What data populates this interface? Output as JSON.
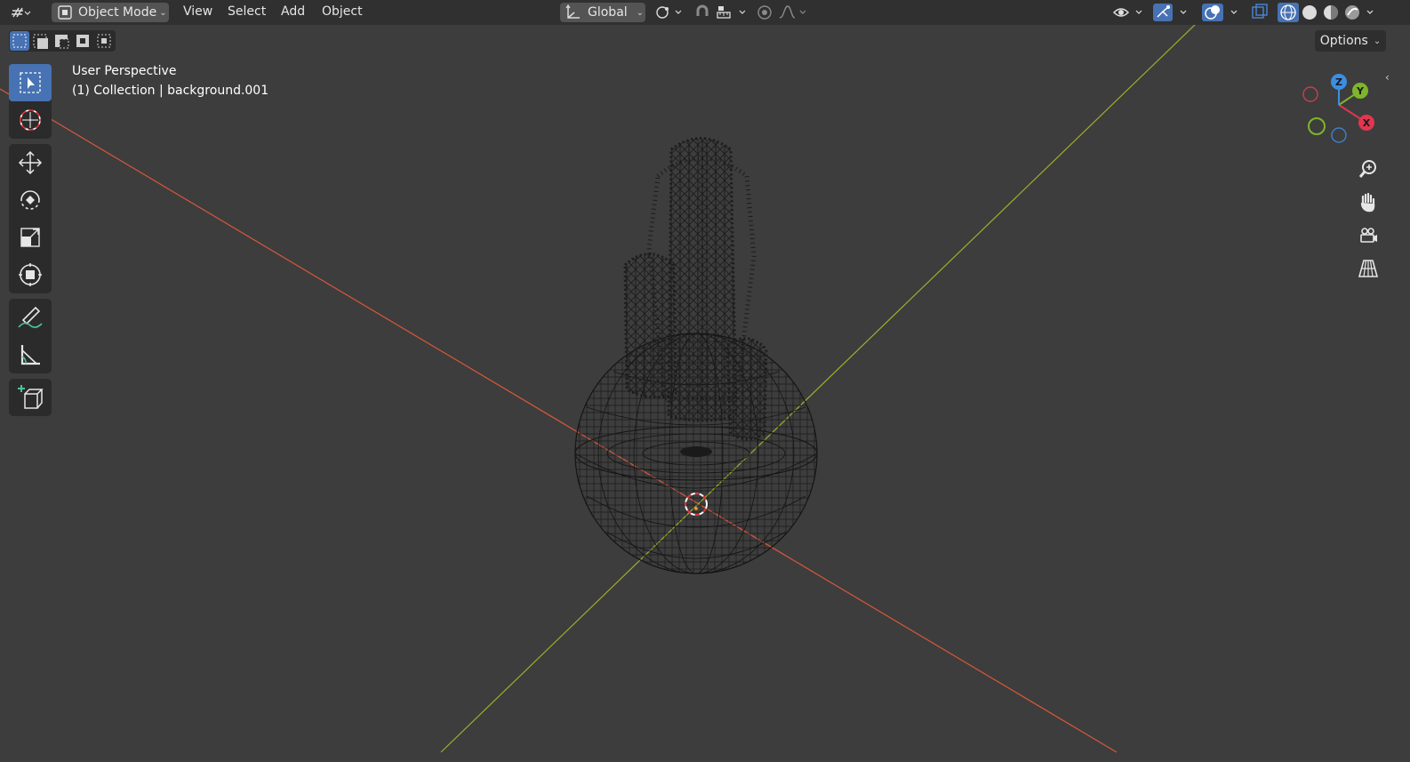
{
  "header": {
    "mode_label": "Object Mode",
    "menus": [
      "View",
      "Select",
      "Add",
      "Object"
    ],
    "orientation_label": "Global"
  },
  "overlay": {
    "perspective_label": "User Perspective",
    "collection_label": "(1) Collection | background.001"
  },
  "options_label": "Options",
  "gizmo": {
    "x_label": "X",
    "y_label": "Y",
    "z_label": "Z"
  },
  "colors": {
    "header_bg": "#303030",
    "viewport_bg": "#3d3d3d",
    "accent": "#4772b3",
    "axis_x": "#e0543b",
    "axis_y": "#9bb320",
    "axis_z": "#3d8ee0",
    "wireframe": "#151515"
  },
  "icons": {
    "editor_type": "editor-type-icon",
    "mode": "object-mode-icon",
    "transform_orientation": "orientation-axes-icon",
    "pivot": "pivot-point-icon",
    "snap": "magnet-icon",
    "snap_target": "snap-increment-icon",
    "proportional": "proportional-edit-icon",
    "falloff": "falloff-curve-icon",
    "visibility": "eye-icon",
    "gizmos": "gizmo-icon",
    "overlays": "overlay-icon",
    "xray": "xray-icon",
    "shading_wire": "wireframe-shading-icon",
    "shading_solid": "solid-shading-icon",
    "shading_material": "material-shading-icon",
    "shading_rendered": "rendered-shading-icon"
  },
  "tools": [
    "select-box",
    "cursor",
    "move",
    "rotate",
    "scale",
    "transform",
    "annotate",
    "measure",
    "add-cube"
  ],
  "active_tool": "select-box"
}
